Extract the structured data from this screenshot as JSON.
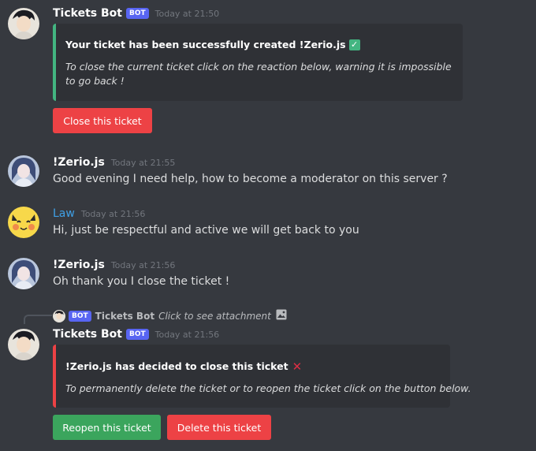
{
  "messages": {
    "m1": {
      "username": "Tickets Bot",
      "bot_tag": "BOT",
      "timestamp": "Today at 21:50",
      "embed": {
        "title": "Your ticket has been successfully created !Zerio.js",
        "title_emoji": "white-check-mark",
        "description": "To close the current ticket click on the reaction below, warning it is impossible to go back !",
        "accent_color": "#43b581"
      },
      "button": "Close this ticket"
    },
    "m2": {
      "username": "!Zerio.js",
      "timestamp": "Today at 21:55",
      "text": "Good evening I need help, how to become a moderator on this server ?"
    },
    "m3": {
      "username": "Law",
      "timestamp": "Today at 21:56",
      "text": "Hi, just be respectful and active we will get back to you"
    },
    "m4": {
      "username": "!Zerio.js",
      "timestamp": "Today at 21:56",
      "text": "Oh thank you I close the ticket !"
    },
    "m5": {
      "reply": {
        "bot_tag": "BOT",
        "username": "Tickets Bot",
        "text": "Click to see attachment"
      },
      "username": "Tickets Bot",
      "bot_tag": "BOT",
      "timestamp": "Today at 21:56",
      "embed": {
        "title": "!Zerio.js has decided to close this ticket",
        "title_emoji": "x-mark",
        "description": "To permanently delete the ticket or to reopen the ticket click on the button below.",
        "accent_color": "#ed4245"
      },
      "buttons": {
        "reopen": "Reopen this ticket",
        "delete": "Delete this ticket"
      }
    }
  },
  "colors": {
    "background": "#36393f",
    "embed_bg": "#2f3136",
    "blurple": "#5865f2",
    "danger": "#ed4245",
    "success": "#3ba55d",
    "law_name": "#3fa0e6"
  }
}
